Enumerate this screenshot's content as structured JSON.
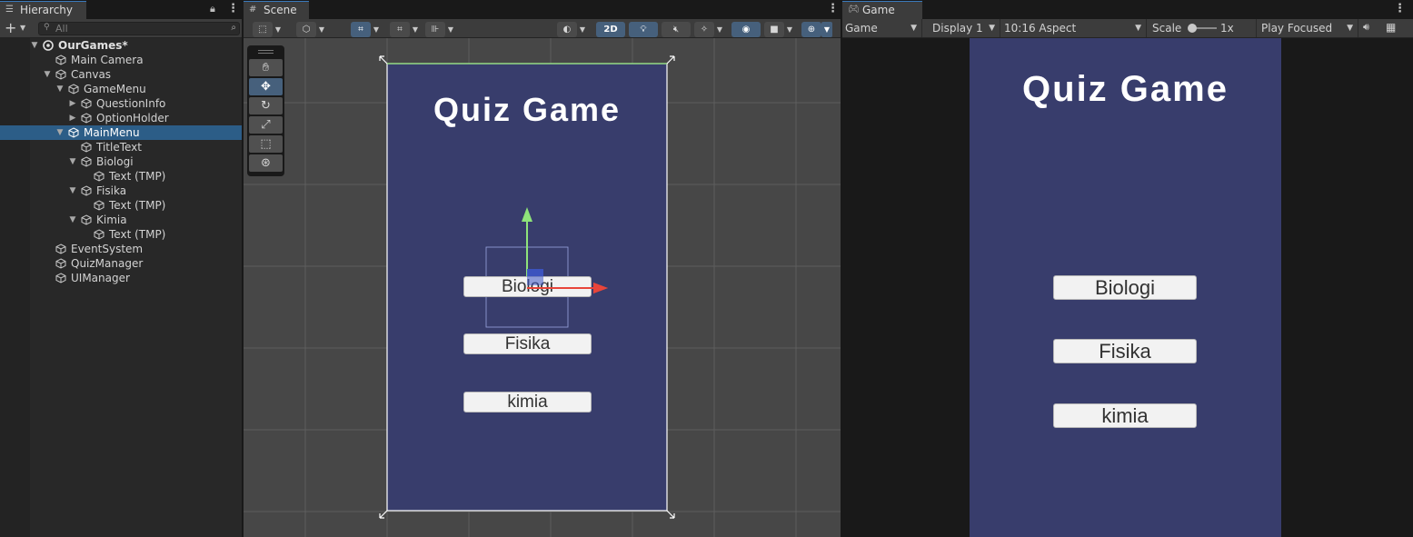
{
  "hierarchy": {
    "tab_label": "Hierarchy",
    "search_placeholder": "All",
    "items": [
      {
        "label": "OurGames*"
      },
      {
        "label": "Main Camera"
      },
      {
        "label": "Canvas"
      },
      {
        "label": "GameMenu"
      },
      {
        "label": "QuestionInfo"
      },
      {
        "label": "OptionHolder"
      },
      {
        "label": "MainMenu",
        "selected": true
      },
      {
        "label": "TitleText"
      },
      {
        "label": "Biologi"
      },
      {
        "label": "Text (TMP)"
      },
      {
        "label": "Fisika"
      },
      {
        "label": "Text (TMP)"
      },
      {
        "label": "Kimia"
      },
      {
        "label": "Text (TMP)"
      },
      {
        "label": "EventSystem"
      },
      {
        "label": "QuizManager"
      },
      {
        "label": "UIManager"
      }
    ]
  },
  "scene": {
    "tab_label": "Scene",
    "toolbar": {
      "mode_2d_label": "2D"
    },
    "canvas": {
      "title": "Quiz Game",
      "buttons": [
        {
          "label": "Biologi"
        },
        {
          "label": "Fisika"
        },
        {
          "label": "kimia"
        }
      ]
    }
  },
  "game": {
    "tab_label": "Game",
    "toolbar": {
      "view_select": "Game",
      "display_select": "Display 1",
      "aspect_select": "10:16 Aspect",
      "scale_label": "Scale",
      "scale_value": "1x",
      "play_mode_select": "Play Focused"
    },
    "canvas": {
      "title": "Quiz Game",
      "buttons": [
        {
          "label": "Biologi"
        },
        {
          "label": "Fisika"
        },
        {
          "label": "kimia"
        }
      ]
    }
  },
  "colors": {
    "canvas_bg": "#383d6c",
    "selection": "#2c5d87",
    "active_tool": "#46607c"
  }
}
